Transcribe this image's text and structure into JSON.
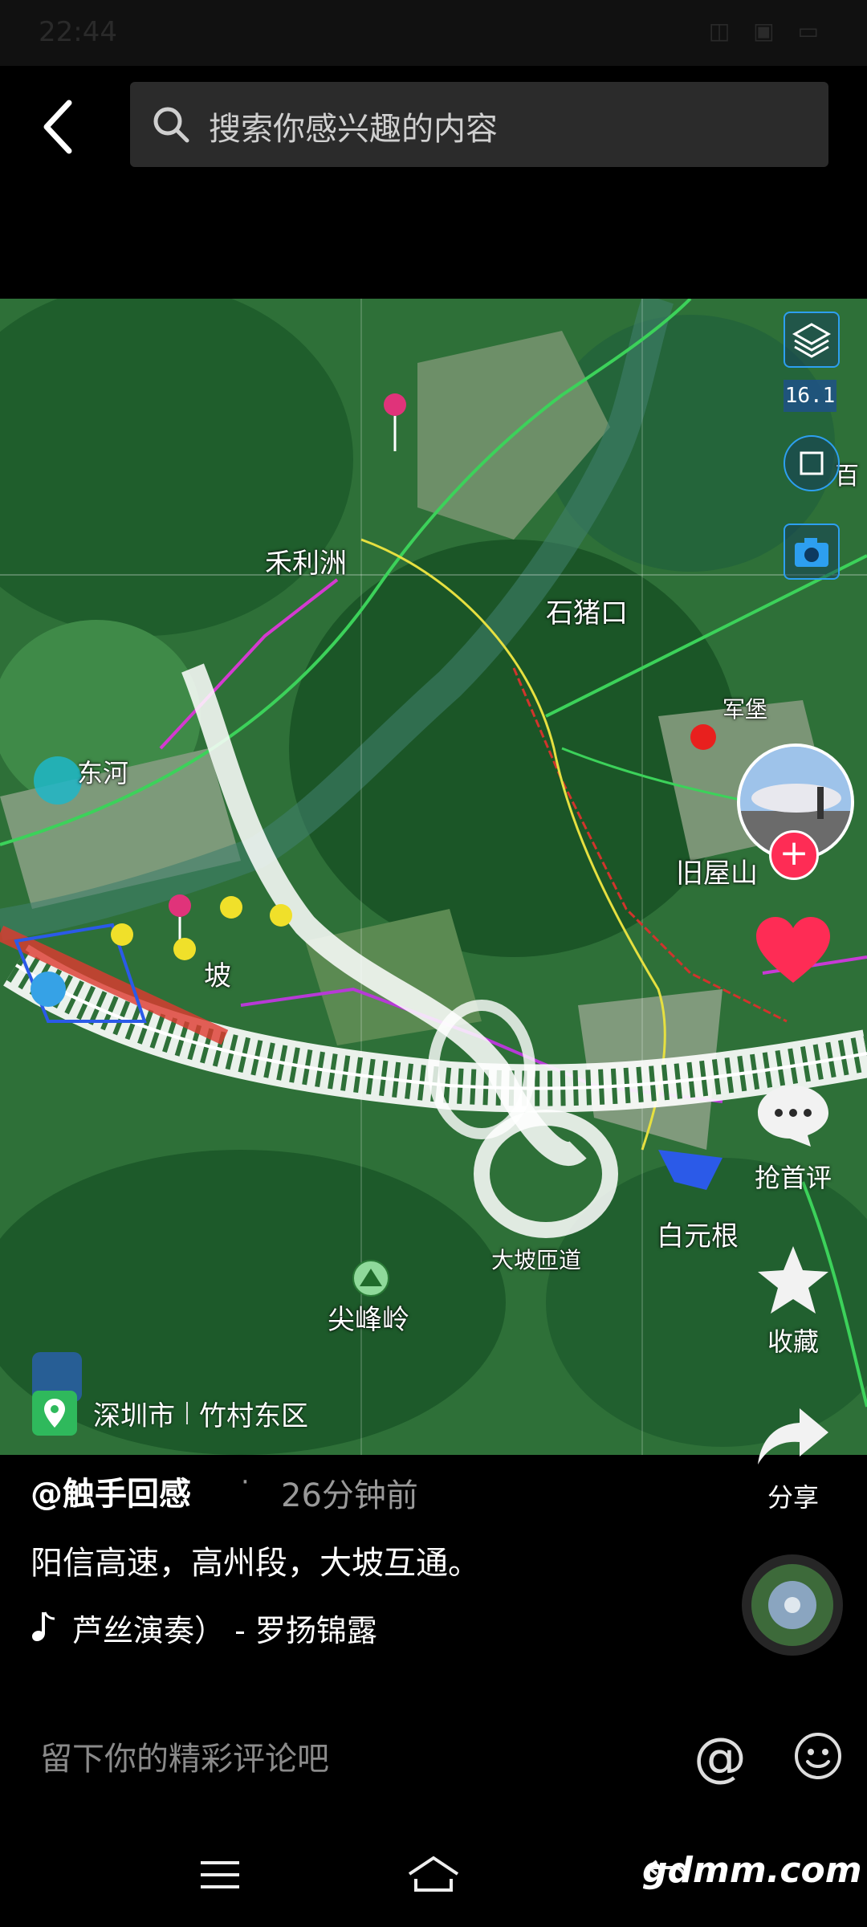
{
  "status_bar": {
    "time": "22:44",
    "icons": "◫ ▣ ▭"
  },
  "header": {
    "search_placeholder": "搜索你感兴趣的内容"
  },
  "map": {
    "zoom": "16.1",
    "labels": {
      "hexili": "禾利洲",
      "shizhukou": "石猪口",
      "junbao": "军堡",
      "donghe": "东河",
      "jiuwushan": "旧屋山",
      "po": "坡",
      "baiyuangen": "白元根",
      "daporamp": "大坡匝道",
      "jianfengling": "尖峰岭",
      "bai": "百"
    }
  },
  "location": {
    "city": "深圳市",
    "district": "竹村东区"
  },
  "actions": {
    "comment_label": "抢首评",
    "favorite_label": "收藏",
    "share_label": "分享"
  },
  "post": {
    "author": "@触手回感",
    "dot": "·",
    "time_ago": "26分钟前",
    "caption": "阳信高速，高州段，大坡互通。",
    "music": "芦丝演奏） - 罗扬锦露"
  },
  "comment": {
    "placeholder": "留下你的精彩评论吧",
    "at": "@"
  },
  "watermark": "gdmm.com"
}
